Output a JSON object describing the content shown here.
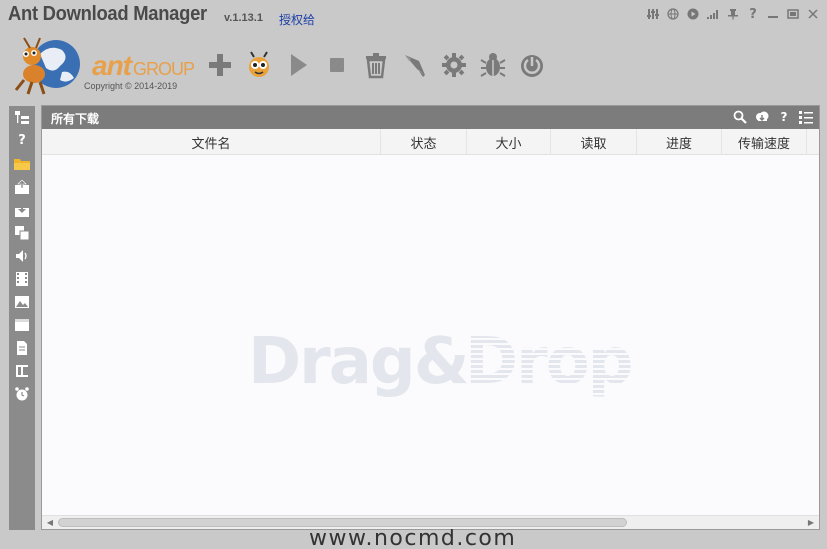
{
  "app": {
    "title": "Ant Download Manager",
    "version": "v.1.13.1",
    "license_link": "授权给"
  },
  "window_controls": [
    "globe-icon",
    "play-circle-icon",
    "speed-meter-icon",
    "pin-icon",
    "help-icon",
    "minimize-icon",
    "restore-icon",
    "close-icon"
  ],
  "brand": {
    "ant": "ant",
    "group": "GROUP",
    "copyright": "Copyright © 2014-2019"
  },
  "toolbar": [
    "add-icon",
    "ant-mascot-icon",
    "play-icon",
    "stop-icon",
    "trash-icon",
    "rocket-icon",
    "gear-icon",
    "bug-icon",
    "power-icon"
  ],
  "sidebar": [
    "tree-icon",
    "help-icon",
    "folder-icon",
    "upload-box-icon",
    "download-box-icon",
    "copy-icon",
    "audio-icon",
    "video-icon",
    "image-icon",
    "calendar-icon",
    "document-icon",
    "text-icon",
    "alarm-clock-icon"
  ],
  "panel": {
    "title": "所有下载",
    "header_icons": [
      "search-icon",
      "cloud-download-icon",
      "help-icon",
      "list-view-icon"
    ],
    "help_glyph": "?"
  },
  "table": {
    "columns": [
      "文件名",
      "状态",
      "大小",
      "读取",
      "进度",
      "传输速度"
    ]
  },
  "dropzone": {
    "drag": "Drag&",
    "drop": "Drop",
    "site": "www.nocmd.com"
  },
  "colors": {
    "background": "#c9c9c9",
    "panel_header": "#7c7c7c",
    "link": "#1b3fa8",
    "accent": "#e8a04a"
  }
}
